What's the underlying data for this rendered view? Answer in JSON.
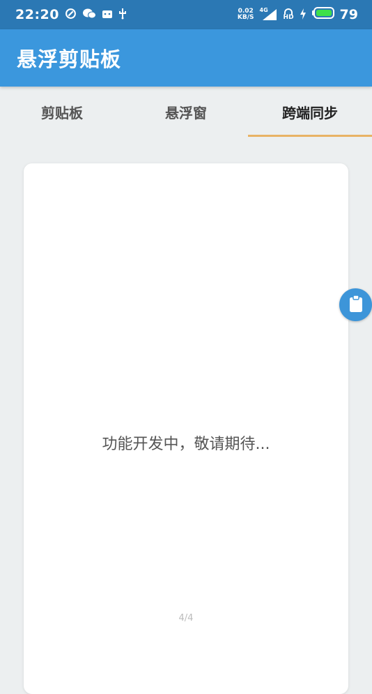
{
  "status_bar": {
    "time": "22:20",
    "net_speed_value": "0.02",
    "net_speed_unit": "KB/S",
    "network_type": "4G",
    "hd_label": "HD",
    "battery_level": "79"
  },
  "app_bar": {
    "title": "悬浮剪贴板"
  },
  "tabs": [
    {
      "label": "剪贴板",
      "active": false
    },
    {
      "label": "悬浮窗",
      "active": false
    },
    {
      "label": "跨端同步",
      "active": true
    }
  ],
  "card": {
    "message": "功能开发中，敬请期待...",
    "page_indicator": "4/4"
  },
  "floating_button": {
    "icon": "clipboard-icon"
  },
  "colors": {
    "status_bar": "#2B78B4",
    "app_bar": "#3B97DD",
    "tab_indicator": "#E8B365",
    "background": "#ECEFF0",
    "floating_button": "#3D95D9"
  }
}
